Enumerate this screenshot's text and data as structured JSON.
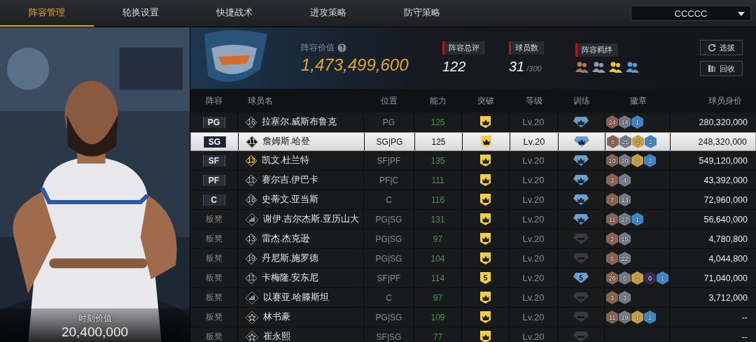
{
  "tabs": [
    {
      "label": "阵容管理",
      "selected": true
    },
    {
      "label": "轮换设置",
      "selected": false
    },
    {
      "label": "快捷战术",
      "selected": false
    },
    {
      "label": "进攻策略",
      "selected": false
    },
    {
      "label": "防守策略",
      "selected": false
    }
  ],
  "team_select": {
    "value": "CCCCC"
  },
  "player_card": {
    "value_label": "时刻价值",
    "value": "20,400,000"
  },
  "summary": {
    "value_label": "阵容价值",
    "value": "1,473,499,600",
    "rating_label": "阵容总评",
    "rating": "122",
    "count_label": "球员数",
    "count": "31",
    "count_max": "/300",
    "bonds_label": "阵容羁绊",
    "bonds": [
      {
        "color": "#a87a58"
      },
      {
        "color": "#8f9bb0"
      },
      {
        "color": "#e8c53a"
      },
      {
        "color": "#4f9ee0"
      }
    ]
  },
  "buttons": [
    {
      "label": "选拔",
      "kind": "refresh"
    },
    {
      "label": "回收",
      "kind": "recycle"
    }
  ],
  "table": {
    "columns": [
      "阵容",
      "球员名",
      "位置",
      "能力",
      "突破",
      "等级",
      "训练",
      "徽章",
      "球员身价"
    ],
    "rows": [
      {
        "slot": "PG",
        "starter": true,
        "jersey": {
          "kind": "number",
          "text": "16"
        },
        "name": "拉塞尔.威斯布鲁克",
        "position": "PG",
        "ability": "125",
        "breakthrough": {
          "kind": "crown"
        },
        "level": "Lv.20",
        "training": {
          "kind": "crown"
        },
        "badges": [
          {
            "count": "24",
            "color": "#8a6452"
          },
          {
            "count": "14",
            "color": "#767b8a"
          },
          {
            "count": "1",
            "color": "#3f86c8"
          }
        ],
        "value": "280,320,000",
        "selected": false
      },
      {
        "slot": "SG",
        "starter": true,
        "jersey": {
          "kind": "number",
          "text": "11"
        },
        "name": "詹姆斯.哈登",
        "position": "SG|PG",
        "ability": "125",
        "breakthrough": {
          "kind": "crown"
        },
        "level": "Lv.20",
        "training": {
          "kind": "crown"
        },
        "badges": [
          {
            "count": "8",
            "color": "#8a6452"
          },
          {
            "count": "25",
            "color": "#767b8a"
          },
          {
            "count": "2",
            "color": "#c8a040"
          },
          {
            "count": "2",
            "color": "#3f86c8"
          }
        ],
        "value": "248,320,000",
        "selected": true
      },
      {
        "slot": "SF",
        "starter": true,
        "jersey": {
          "kind": "gold",
          "text": "13"
        },
        "name": "凯文.杜兰特",
        "position": "SF|PF",
        "ability": "135",
        "breakthrough": {
          "kind": "crown"
        },
        "level": "Lv.20",
        "training": {
          "kind": "crown"
        },
        "badges": [
          {
            "count": "10",
            "color": "#8a6452"
          },
          {
            "count": "20",
            "color": "#767b8a"
          },
          {
            "count": "9",
            "color": "#c8a040"
          },
          {
            "count": "3",
            "color": "#3f86c8"
          }
        ],
        "value": "549,120,000",
        "selected": false
      },
      {
        "slot": "PF",
        "starter": true,
        "jersey": {
          "kind": "number",
          "text": "11"
        },
        "name": "赛尔吉.伊巴卡",
        "position": "PF|C",
        "ability": "111",
        "breakthrough": {
          "kind": "crown"
        },
        "level": "Lv.20",
        "training": {
          "kind": "crown"
        },
        "badges": [
          {
            "count": "3",
            "color": "#8a6452"
          },
          {
            "count": "4",
            "color": "#767b8a"
          }
        ],
        "value": "43,392,000",
        "selected": false
      },
      {
        "slot": "C",
        "starter": true,
        "jersey": {
          "kind": "number",
          "text": "18"
        },
        "name": "史蒂文.亚当斯",
        "position": "C",
        "ability": "116",
        "breakthrough": {
          "kind": "crown"
        },
        "level": "Lv.20",
        "training": {
          "kind": "crown"
        },
        "badges": [
          {
            "count": "7",
            "color": "#8a6452"
          },
          {
            "count": "13",
            "color": "#767b8a"
          }
        ],
        "value": "72,960,000",
        "selected": false
      },
      {
        "slot": "板凳",
        "starter": false,
        "jersey": {
          "kind": "bars"
        },
        "name": "谢伊.吉尔杰斯.亚历山大",
        "position": "PG|SG",
        "ability": "131",
        "breakthrough": {
          "kind": "crown"
        },
        "level": "Lv.20",
        "training": {
          "kind": "crown"
        },
        "badges": [
          {
            "count": "11",
            "color": "#8a6452"
          },
          {
            "count": "27",
            "color": "#767b8a"
          },
          {
            "count": "1",
            "color": "#3f86c8"
          }
        ],
        "value": "56,640,000",
        "selected": false
      },
      {
        "slot": "板凳",
        "starter": false,
        "jersey": {
          "kind": "number",
          "text": "13"
        },
        "name": "雷杰.杰克逊",
        "position": "PG|SG",
        "ability": "97",
        "breakthrough": {
          "kind": "crown"
        },
        "level": "Lv.20",
        "training": {
          "kind": "empty"
        },
        "badges": [
          {
            "count": "2",
            "color": "#8a6452"
          },
          {
            "count": "15",
            "color": "#767b8a"
          }
        ],
        "value": "4,780,800",
        "selected": false
      },
      {
        "slot": "板凳",
        "starter": false,
        "jersey": {
          "kind": "number",
          "text": "19"
        },
        "name": "丹尼斯.施罗德",
        "position": "PG|SG",
        "ability": "104",
        "breakthrough": {
          "kind": "crown"
        },
        "level": "Lv.20",
        "training": {
          "kind": "empty"
        },
        "badges": [
          {
            "count": "6",
            "color": "#8a6452"
          },
          {
            "count": "22",
            "color": "#767b8a"
          }
        ],
        "value": "4,044,800",
        "selected": false
      },
      {
        "slot": "板凳",
        "starter": false,
        "jersey": {
          "kind": "number",
          "text": "11"
        },
        "name": "卡梅隆.安东尼",
        "position": "SF|PF",
        "ability": "114",
        "breakthrough": {
          "kind": "number",
          "text": "5"
        },
        "level": "Lv.20",
        "training": {
          "kind": "number",
          "text": "5"
        },
        "badges": [
          {
            "count": "26",
            "color": "#8a6452"
          },
          {
            "count": "6",
            "color": "#767b8a"
          },
          {
            "count": "3",
            "color": "#c8a040"
          },
          {
            "count": "0",
            "color": "#3a2a5a"
          },
          {
            "count": "1",
            "color": "#3f86c8"
          }
        ],
        "value": "71,040,000",
        "selected": false
      },
      {
        "slot": "板凳",
        "starter": false,
        "jersey": {
          "kind": "bars"
        },
        "name": "以赛亚.哈滕斯坦",
        "position": "C",
        "ability": "97",
        "breakthrough": {
          "kind": "crown"
        },
        "level": "Lv.20",
        "training": {
          "kind": "empty"
        },
        "badges": [
          {
            "count": "3",
            "color": "#8a6452"
          },
          {
            "count": "3",
            "color": "#767b8a"
          }
        ],
        "value": "3,712,000",
        "selected": false
      },
      {
        "slot": "板凳",
        "starter": false,
        "jersey": {
          "kind": "star"
        },
        "name": "林书豪",
        "position": "PG|SG",
        "ability": "109",
        "breakthrough": {
          "kind": "crown"
        },
        "level": "Lv.20",
        "training": {
          "kind": "empty"
        },
        "badges": [
          {
            "count": "11",
            "color": "#8a6452"
          },
          {
            "count": "19",
            "color": "#767b8a"
          },
          {
            "count": "1",
            "color": "#c8a040"
          },
          {
            "count": "1",
            "color": "#3f86c8"
          }
        ],
        "value": "--",
        "selected": false
      },
      {
        "slot": "板凳",
        "starter": false,
        "jersey": {
          "kind": "star"
        },
        "name": "崔永熙",
        "position": "SF|SG",
        "ability": "77",
        "breakthrough": {
          "kind": "crown"
        },
        "level": "Lv.20",
        "training": {
          "kind": "empty"
        },
        "badges": [],
        "value": "--",
        "selected": false
      }
    ]
  }
}
